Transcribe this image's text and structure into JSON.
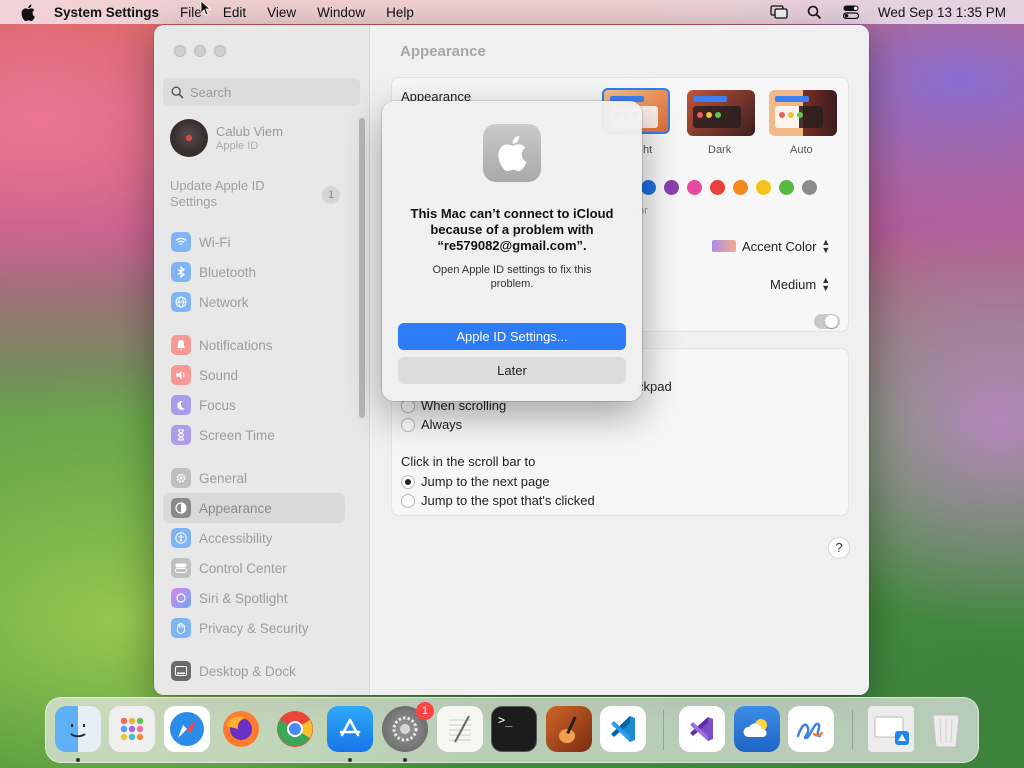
{
  "menubar": {
    "app_name": "System Settings",
    "menus": [
      "File",
      "Edit",
      "View",
      "Window",
      "Help"
    ],
    "clock": "Wed Sep 13  1:35 PM"
  },
  "sidebar": {
    "search_placeholder": "Search",
    "account": {
      "name": "Calub Viem",
      "subtitle": "Apple ID"
    },
    "update": {
      "label": "Update Apple ID Settings",
      "badge": "1"
    },
    "groups": [
      [
        {
          "label": "Wi-Fi",
          "icon": "wifi-icon",
          "color": "#3b8ff3"
        },
        {
          "label": "Bluetooth",
          "icon": "bluetooth-icon",
          "color": "#3b8ff3"
        },
        {
          "label": "Network",
          "icon": "globe-icon",
          "color": "#3b8ff3"
        }
      ],
      [
        {
          "label": "Notifications",
          "icon": "bell-icon",
          "color": "#f0504a"
        },
        {
          "label": "Sound",
          "icon": "speaker-icon",
          "color": "#f0504a"
        },
        {
          "label": "Focus",
          "icon": "moon-icon",
          "color": "#6a5bd6"
        },
        {
          "label": "Screen Time",
          "icon": "hourglass-icon",
          "color": "#7a5bd6"
        }
      ],
      [
        {
          "label": "General",
          "icon": "gear-icon",
          "color": "#9a9a9a"
        },
        {
          "label": "Appearance",
          "icon": "appearance-icon",
          "color": "#222222",
          "selected": true
        },
        {
          "label": "Accessibility",
          "icon": "accessibility-icon",
          "color": "#3b8ff3"
        },
        {
          "label": "Control Center",
          "icon": "control-center-icon",
          "color": "#9a9a9a"
        },
        {
          "label": "Siri & Spotlight",
          "icon": "siri-icon",
          "color": "#b35bd6"
        },
        {
          "label": "Privacy & Security",
          "icon": "hand-icon",
          "color": "#3b8ff3"
        }
      ],
      [
        {
          "label": "Desktop & Dock",
          "icon": "dock-icon",
          "color": "#222222"
        }
      ]
    ]
  },
  "main": {
    "title": "Appearance",
    "appearance_label": "Appearance",
    "modes": [
      "ht",
      "Dark",
      "Auto"
    ],
    "accent_fragment": "or",
    "highlight_color": "Accent Color",
    "sidebar_icon_size": "Medium",
    "scroll_fragment": "ckpad",
    "show_scroll_options": [
      "When scrolling",
      "Always"
    ],
    "click_scroll_label": "Click in the scroll bar to",
    "click_scroll_options": [
      "Jump to the next page",
      "Jump to the spot that's clicked"
    ],
    "help": "?",
    "accent_colors": [
      "#1f6fe0",
      "#8a3fb0",
      "#e94aa0",
      "#e8403b",
      "#f5891f",
      "#f4c31c",
      "#5ab845",
      "#8c8c8c"
    ]
  },
  "alert": {
    "title": "This Mac can’t connect to iCloud because of a problem with “re579082@gmail.com”.",
    "message": "Open Apple ID settings to fix this problem.",
    "primary_button": "Apple ID Settings...",
    "secondary_button": "Later"
  },
  "dock": {
    "settings_badge": "1",
    "apps": [
      {
        "name": "finder-icon",
        "color": "#3a8ef0"
      },
      {
        "name": "launchpad-icon",
        "color": "#eeeeee"
      },
      {
        "name": "safari-icon",
        "color": "#2b8de8"
      },
      {
        "name": "firefox-icon",
        "color": "#ff7b2f"
      },
      {
        "name": "chrome-icon",
        "color": "#ffffff"
      },
      {
        "name": "app-store-icon",
        "color": "#1c8cf2"
      },
      {
        "name": "system-settings-icon",
        "color": "#7e7e7e"
      },
      {
        "name": "textedit-icon",
        "color": "#f6f6f6"
      },
      {
        "name": "terminal-icon",
        "color": "#1c1c1c"
      },
      {
        "name": "garageband-icon",
        "color": "#e0701f"
      },
      {
        "name": "vscode-icon",
        "color": "#ffffff"
      },
      {
        "name": "visual-studio-icon",
        "color": "#ffffff"
      },
      {
        "name": "weather-icon",
        "color": "#2d7fd8"
      },
      {
        "name": "freeform-icon",
        "color": "#ffffff"
      },
      {
        "name": "downloads-stack-icon",
        "color": "#eeeeee"
      },
      {
        "name": "trash-icon",
        "color": "#e6e6e6"
      }
    ]
  }
}
